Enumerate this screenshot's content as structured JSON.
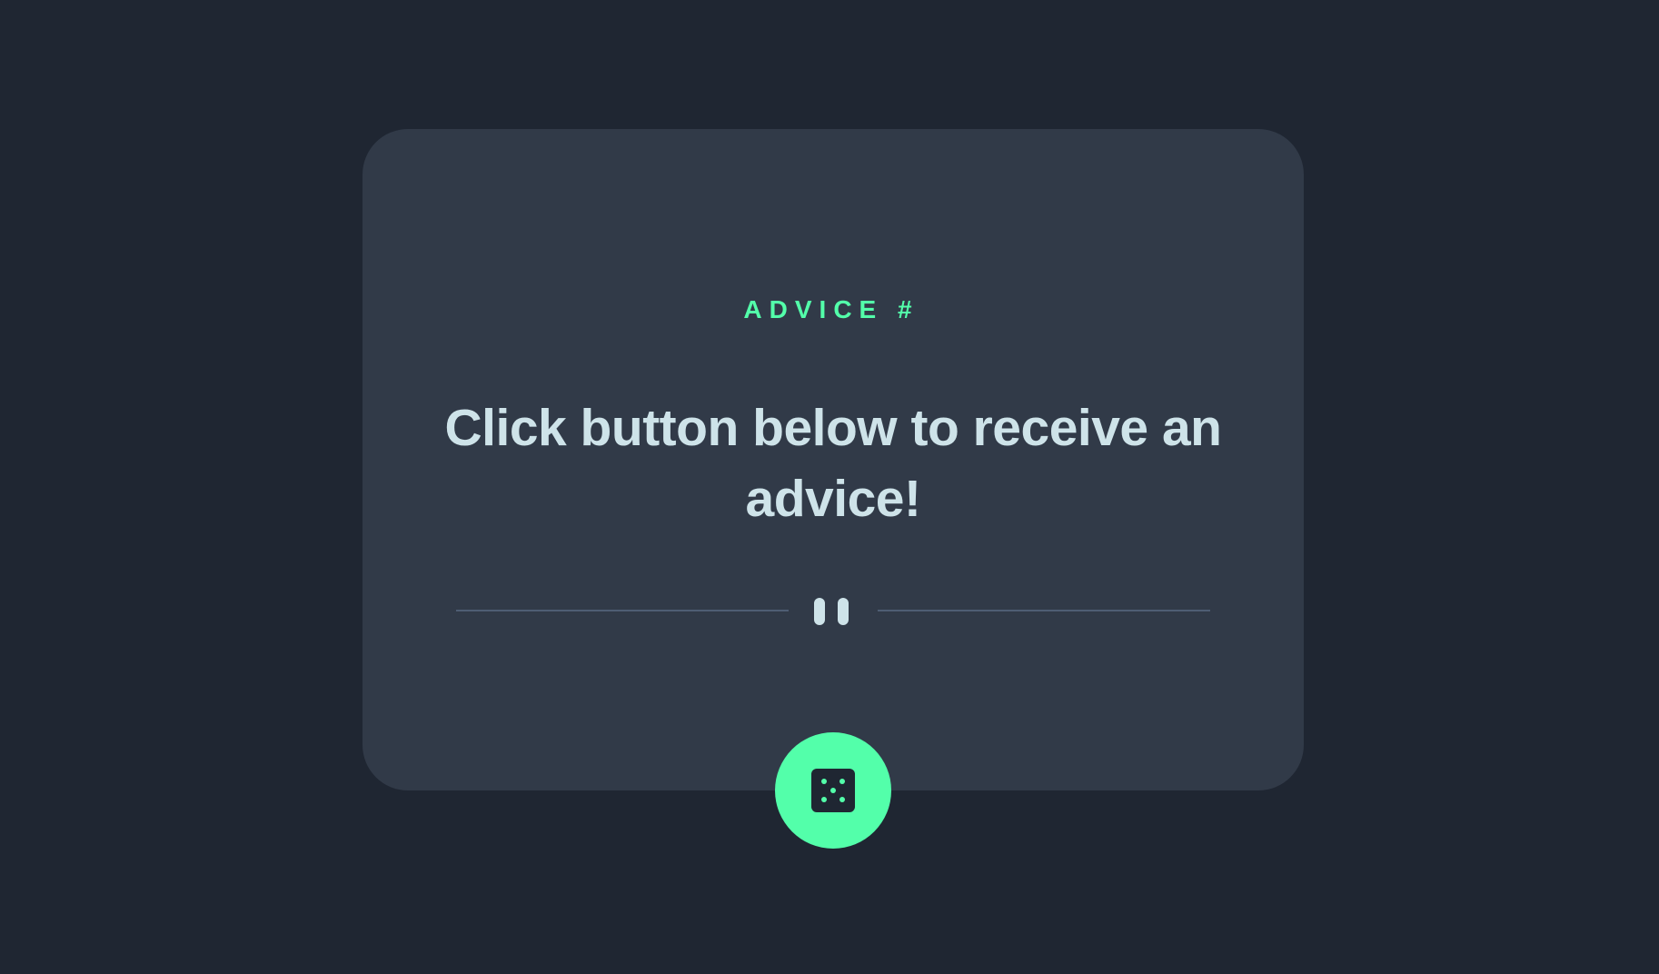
{
  "card": {
    "advice_label": "ADVICE #",
    "advice_number": "",
    "quote": "Click button below to receive an advice!"
  },
  "icons": {
    "divider": "pause-icon",
    "button": "dice-icon"
  },
  "colors": {
    "background": "#1f2632",
    "card": "#313a48",
    "accent": "#53ffaa",
    "text": "#cee3e9",
    "divider": "#4e5d73"
  }
}
